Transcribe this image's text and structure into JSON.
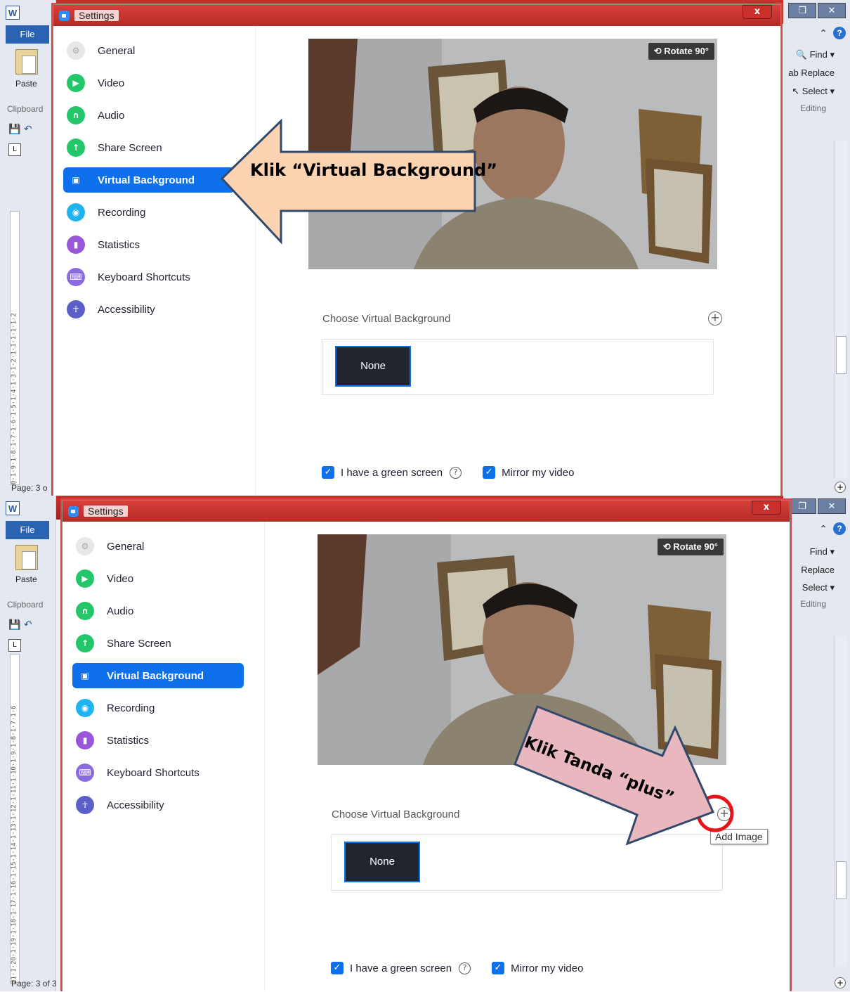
{
  "word": {
    "logo": "W",
    "file_tab": "File",
    "paste": "Paste",
    "clipboard": "Clipboard",
    "find": "Find",
    "replace": "Replace",
    "select": "Select",
    "editing": "Editing",
    "page_status_1": "Page: 3 o",
    "page_status_2": "Page: 3 of 3",
    "ruler_1": "0·1·9·1·8·1·7·1·6·1·5·1·4·1·3·1·2·1·1·1·1·1·2",
    "ruler_2": "21·1·20·1·19·1·18·1·17·1·16·1·15·1·14·1·13·1·12·1·11·1·10·1·9·1·8·1·7·1·6",
    "restore_icon": "restore-icon",
    "close_icon": "close-icon"
  },
  "settings": {
    "title": "Settings",
    "close": "x",
    "nav": [
      {
        "label": "General",
        "icon": "gear-icon",
        "color": "#e8e8e8"
      },
      {
        "label": "Video",
        "icon": "camera-icon",
        "color": "#23c76a"
      },
      {
        "label": "Audio",
        "icon": "headphones-icon",
        "color": "#23c76a"
      },
      {
        "label": "Share Screen",
        "icon": "share-screen-icon",
        "color": "#23c76a"
      },
      {
        "label": "Virtual Background",
        "icon": "portrait-icon",
        "color": "#0e71eb"
      },
      {
        "label": "Recording",
        "icon": "record-icon",
        "color": "#1fb3f0"
      },
      {
        "label": "Statistics",
        "icon": "bar-chart-icon",
        "color": "#9a56d8"
      },
      {
        "label": "Keyboard Shortcuts",
        "icon": "keyboard-icon",
        "color": "#8a6ce0"
      },
      {
        "label": "Accessibility",
        "icon": "accessibility-icon",
        "color": "#5b5fc7"
      }
    ],
    "rotate": "Rotate 90°",
    "choose": "Choose Virtual Background",
    "none": "None",
    "green_screen": "I have a green screen",
    "mirror": "Mirror my video",
    "add_image_tooltip": "Add Image"
  },
  "annotations": {
    "callout_1": "Klik “Virtual Background”",
    "callout_2": "Klik Tanda “plus”",
    "arrow_1_color": "#fbd3b0",
    "arrow_2_color": "#e8b8be"
  }
}
